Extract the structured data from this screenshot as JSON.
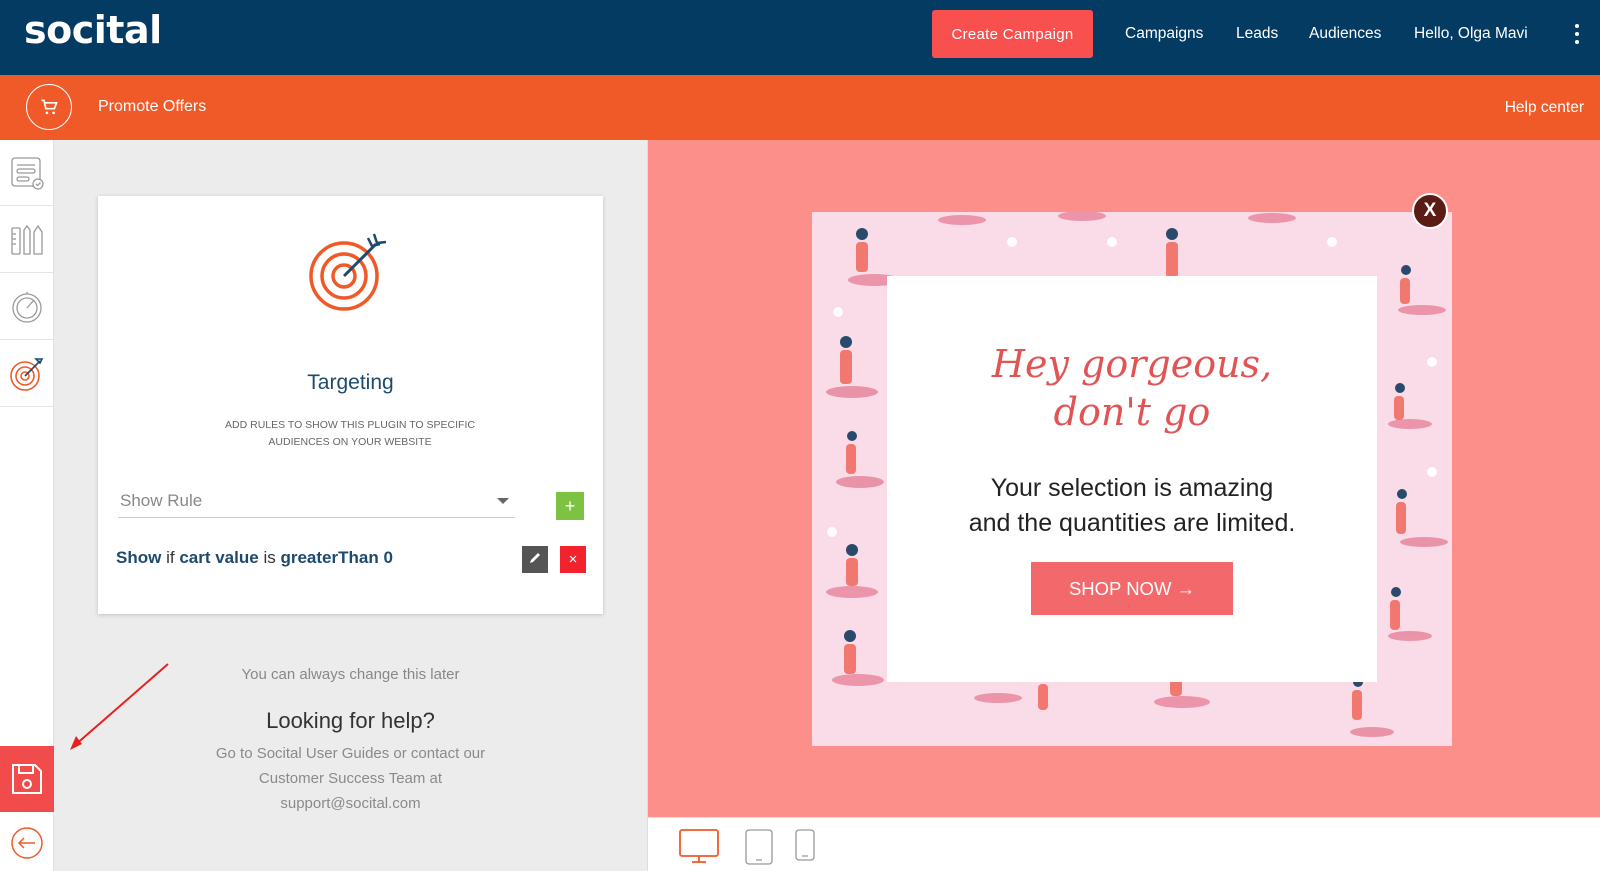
{
  "header": {
    "logo": "socital",
    "create_campaign": "Create Campaign",
    "nav": [
      "Campaigns",
      "Leads",
      "Audiences",
      "Hello, Olga Mavi"
    ],
    "menu_icon": "kebab-menu-icon"
  },
  "subheader": {
    "icon": "shopping-cart-icon",
    "title": "Promote Offers",
    "help": "Help center"
  },
  "sidebar": {
    "items": [
      {
        "icon": "form-settings-icon"
      },
      {
        "icon": "design-tools-icon"
      },
      {
        "icon": "timing-gauge-icon"
      },
      {
        "icon": "targeting-icon",
        "active": true
      }
    ],
    "save_icon": "save-icon",
    "back_icon": "arrow-left-icon"
  },
  "targeting": {
    "title": "Targeting",
    "subtitle": "ADD RULES TO SHOW THIS PLUGIN TO SPECIFIC AUDIENCES ON YOUR WEBSITE",
    "select_value": "Show Rule",
    "add_label": "+",
    "rule": {
      "action": "Show",
      "w1": "if",
      "field": "cart value",
      "w2": "is",
      "operator": "greaterThan",
      "value": "0"
    },
    "delete_label": "×"
  },
  "help": {
    "note": "You can always change this later",
    "title": "Looking for help?",
    "text": "Go to Socital User Guides or contact our Customer Success Team at support@socital.com"
  },
  "preview": {
    "headline_1": "Hey gorgeous,",
    "headline_2": "don't go",
    "body_1": "Your selection is amazing",
    "body_2": "and the quantities are limited.",
    "button": "SHOP NOW →",
    "close": "X",
    "devices": [
      "desktop-icon",
      "tablet-icon",
      "mobile-icon"
    ]
  },
  "colors": {
    "header_bg": "#033b63",
    "subbar_bg": "#f05a28",
    "create_btn": "#f8504f",
    "preview_bg": "#fd8f8a",
    "popup_pattern": "#fadce8",
    "accent_green": "#7dc242",
    "delete_red": "#f2232d"
  }
}
